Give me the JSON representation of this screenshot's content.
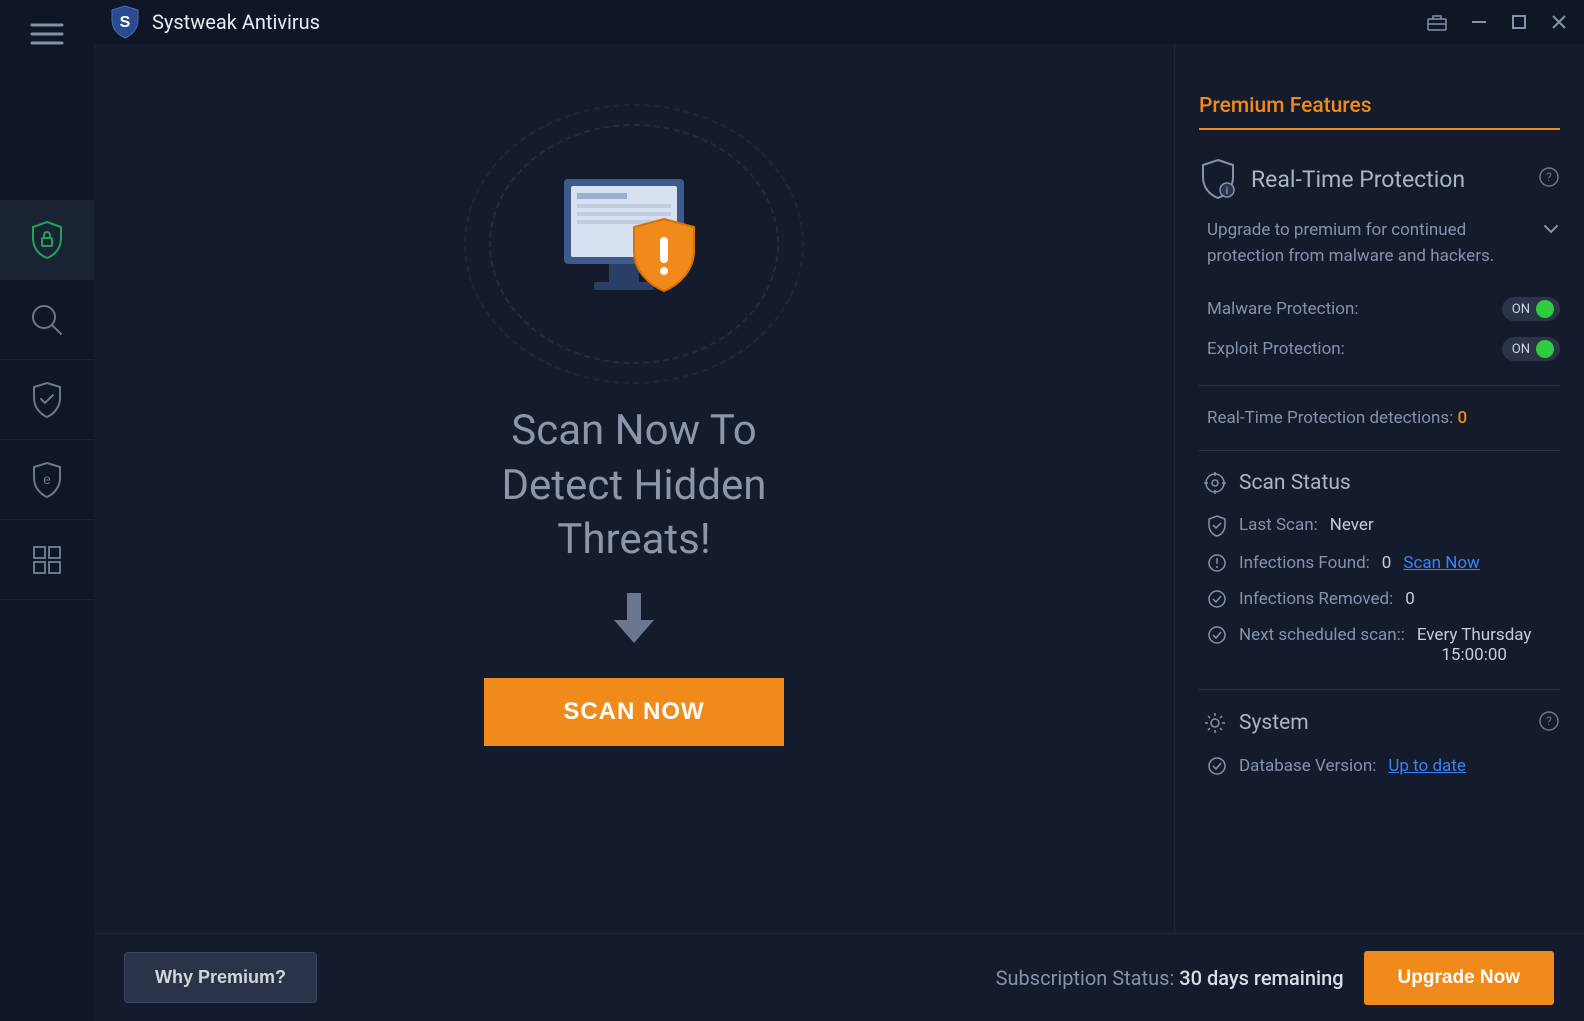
{
  "titlebar": {
    "title": "Systweak Antivirus"
  },
  "hero": {
    "headline_l1": "Scan Now To",
    "headline_l2": "Detect Hidden",
    "headline_l3": "Threats!",
    "scan_button": "SCAN NOW"
  },
  "right": {
    "premium_header": "Premium Features",
    "realtime": {
      "title": "Real-Time Protection",
      "desc": "Upgrade to premium for continued protection from malware and hackers.",
      "malware_label": "Malware Protection:",
      "malware_toggle": "ON",
      "exploit_label": "Exploit Protection:",
      "exploit_toggle": "ON",
      "detections_label": "Real-Time Protection detections:",
      "detections_count": "0"
    },
    "scan_status": {
      "title": "Scan Status",
      "last_scan_label": "Last Scan:",
      "last_scan_value": "Never",
      "infections_found_label": "Infections Found:",
      "infections_found_value": "0",
      "scan_now_link": "Scan Now",
      "infections_removed_label": "Infections Removed:",
      "infections_removed_value": "0",
      "next_scan_label": "Next scheduled scan::",
      "next_scan_value": "Every Thursday",
      "next_scan_time": "15:00:00"
    },
    "system": {
      "title": "System",
      "db_label": "Database Version:",
      "db_value": "Up to date"
    }
  },
  "footer": {
    "why_premium": "Why Premium?",
    "sub_label": "Subscription Status:",
    "sub_value": "30 days remaining",
    "upgrade": "Upgrade Now"
  }
}
